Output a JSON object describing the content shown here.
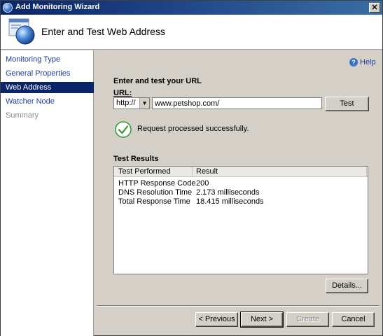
{
  "window": {
    "title": "Add Monitoring Wizard",
    "close_glyph": "✕"
  },
  "header": {
    "title": "Enter and Test Web Address",
    "icon": "wizard-globe-icon"
  },
  "nav": {
    "items": [
      {
        "label": "Monitoring Type",
        "state": "normal"
      },
      {
        "label": "General Properties",
        "state": "normal"
      },
      {
        "label": "Web Address",
        "state": "active"
      },
      {
        "label": "Watcher Node",
        "state": "normal"
      },
      {
        "label": "Summary",
        "state": "disabled"
      }
    ]
  },
  "help": {
    "label": "Help",
    "icon_glyph": "?"
  },
  "url_section": {
    "heading": "Enter and test your URL",
    "url_label": "URL:",
    "protocol_value": "http://",
    "url_value": "www.petshop.com/",
    "test_button": "Test"
  },
  "status": {
    "message": "Request processed successfully.",
    "icon": "check-circle-icon"
  },
  "results": {
    "heading": "Test Results",
    "columns": [
      "Test Performed",
      "Result"
    ],
    "rows": [
      {
        "test": "HTTP Response Code",
        "result": "200"
      },
      {
        "test": "DNS Resolution Time",
        "result": "2.173 milliseconds"
      },
      {
        "test": "Total Response Time",
        "result": "18.415 milliseconds"
      }
    ],
    "details_button": "Details..."
  },
  "footer": {
    "previous": "< Previous",
    "next": "Next >",
    "create": "Create",
    "cancel": "Cancel"
  },
  "colors": {
    "titlebar_start": "#0a246a",
    "titlebar_end": "#3a6ea5",
    "nav_active_bg": "#0a246a",
    "link": "#1f3e9e",
    "success": "#2e9a2e"
  }
}
